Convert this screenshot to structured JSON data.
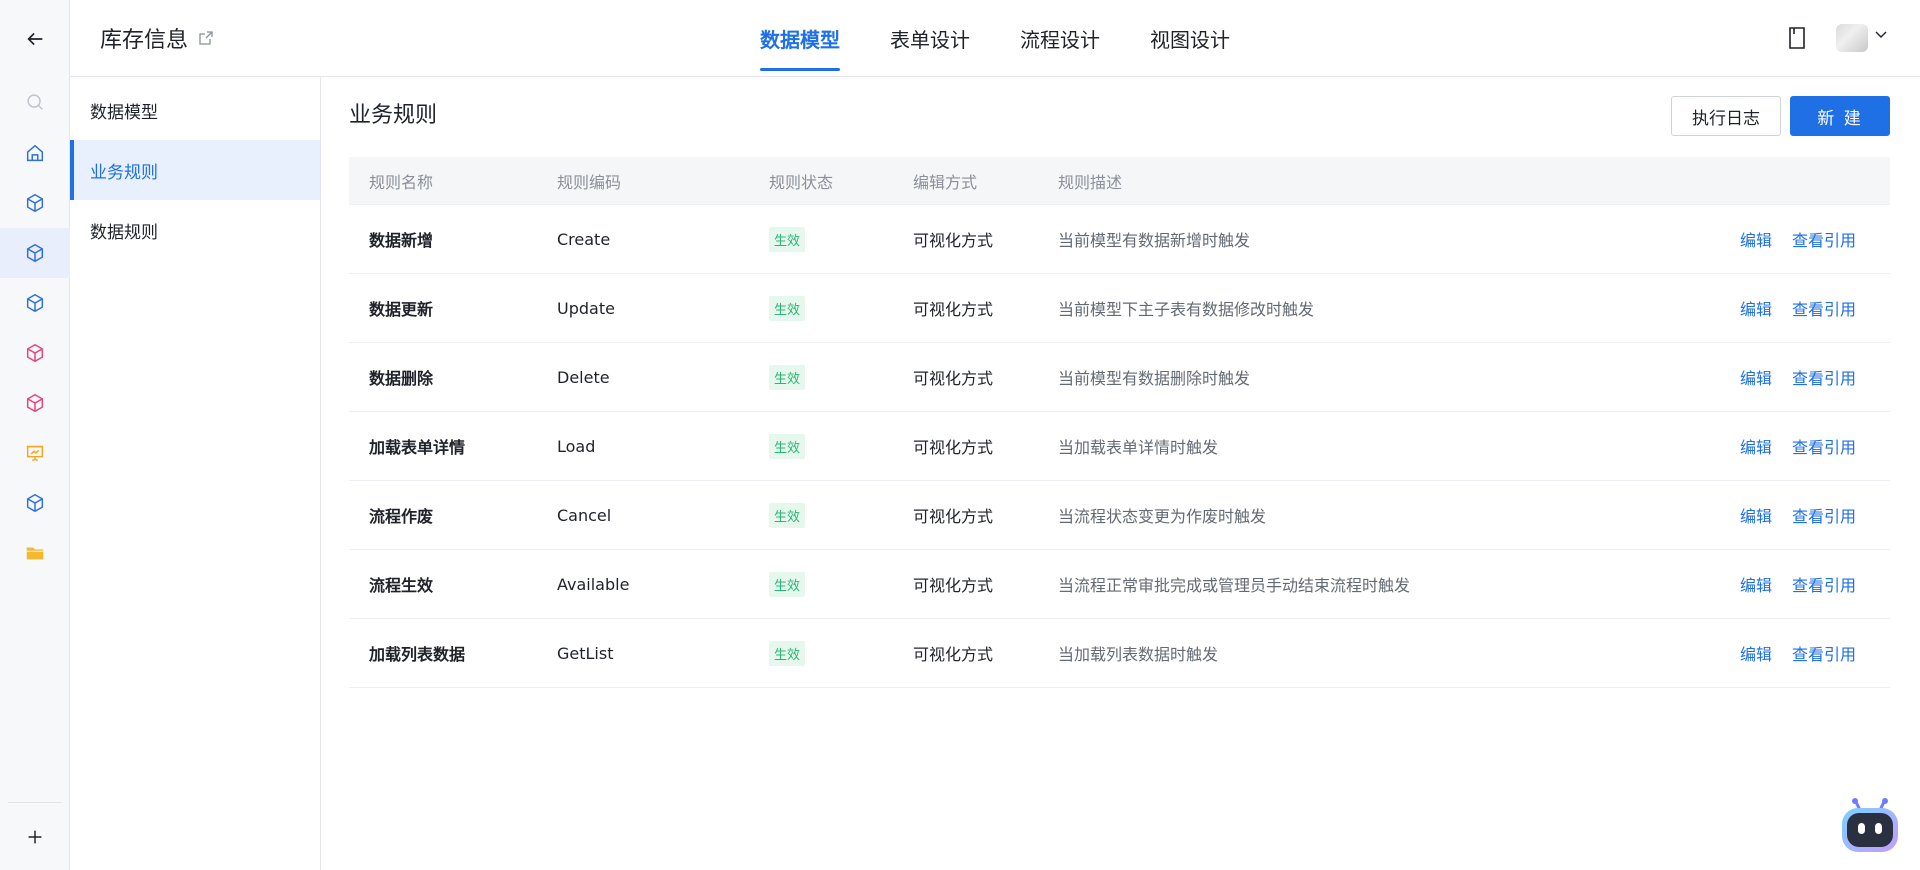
{
  "header": {
    "app_title": "库存信息",
    "tabs": [
      {
        "label": "数据模型",
        "active": true
      },
      {
        "label": "表单设计",
        "active": false
      },
      {
        "label": "流程设计",
        "active": false
      },
      {
        "label": "视图设计",
        "active": false
      }
    ]
  },
  "rail": {
    "items": [
      "back-arrow-icon",
      "search-icon",
      "home-icon",
      "cube-icon",
      "cube-icon",
      "cube-icon",
      "cube-icon",
      "cube-icon",
      "presentation-icon",
      "cube-icon",
      "folder-icon",
      "plus-icon"
    ],
    "colors": {
      "blue": "#2f6fe0",
      "pink": "#e8437a",
      "orange": "#f5a623",
      "gray": "#8a8f99"
    }
  },
  "subnav": {
    "items": [
      {
        "label": "数据模型",
        "active": false
      },
      {
        "label": "业务规则",
        "active": true
      },
      {
        "label": "数据规则",
        "active": false
      }
    ]
  },
  "main": {
    "title": "业务规则",
    "log_button": "执行日志",
    "new_button": "新 建",
    "columns": [
      "规则名称",
      "规则编码",
      "规则状态",
      "编辑方式",
      "规则描述"
    ],
    "rows": [
      {
        "name": "数据新增",
        "code": "Create",
        "status": "生效",
        "mode": "可视化方式",
        "desc": "当前模型有数据新增时触发",
        "edit": "编辑",
        "refs": "查看引用"
      },
      {
        "name": "数据更新",
        "code": "Update",
        "status": "生效",
        "mode": "可视化方式",
        "desc": "当前模型下主子表有数据修改时触发",
        "edit": "编辑",
        "refs": "查看引用"
      },
      {
        "name": "数据删除",
        "code": "Delete",
        "status": "生效",
        "mode": "可视化方式",
        "desc": "当前模型有数据删除时触发",
        "edit": "编辑",
        "refs": "查看引用"
      },
      {
        "name": "加载表单详情",
        "code": "Load",
        "status": "生效",
        "mode": "可视化方式",
        "desc": "当加载表单详情时触发",
        "edit": "编辑",
        "refs": "查看引用"
      },
      {
        "name": "流程作废",
        "code": "Cancel",
        "status": "生效",
        "mode": "可视化方式",
        "desc": "当流程状态变更为作废时触发",
        "edit": "编辑",
        "refs": "查看引用"
      },
      {
        "name": "流程生效",
        "code": "Available",
        "status": "生效",
        "mode": "可视化方式",
        "desc": "当流程正常审批完成或管理员手动结束流程时触发",
        "edit": "编辑",
        "refs": "查看引用"
      },
      {
        "name": "加载列表数据",
        "code": "GetList",
        "status": "生效",
        "mode": "可视化方式",
        "desc": "当加载列表数据时触发",
        "edit": "编辑",
        "refs": "查看引用"
      }
    ]
  },
  "accent_color": "#1f6fe5",
  "status_color": "#2bb673"
}
